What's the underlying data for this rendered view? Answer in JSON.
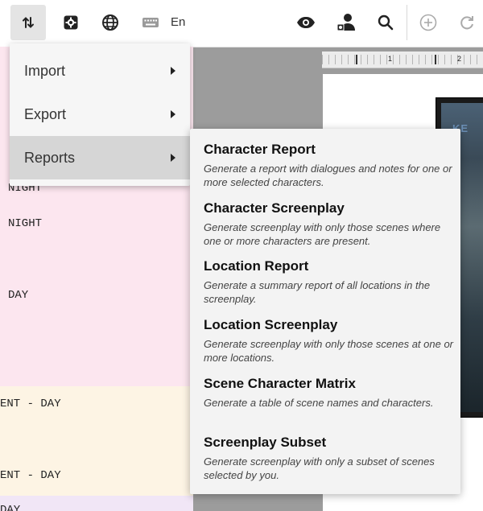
{
  "toolbar": {
    "language_label": "En",
    "icons": [
      "sort-arrows-icon",
      "settings-icon",
      "globe-icon",
      "keyboard-icon",
      "eye-icon",
      "users-icon",
      "search-icon",
      "add-icon",
      "redo-icon"
    ]
  },
  "menu": {
    "items": [
      {
        "label": "Import"
      },
      {
        "label": "Export"
      },
      {
        "label": "Reports"
      }
    ]
  },
  "reports": {
    "items": [
      {
        "title": "Character Report",
        "description": "Generate a report with dialogues and notes for one or more selected characters."
      },
      {
        "title": "Character Screenplay",
        "description": "Generate screenplay with only those scenes where one or more characters are present."
      },
      {
        "title": "Location Report",
        "description": "Generate a summary report of all locations in the screenplay."
      },
      {
        "title": "Location Screenplay",
        "description": "Generate screenplay with only those scenes at one or more locations."
      },
      {
        "title": "Scene Character Matrix",
        "description": "Generate a table of scene names and characters."
      },
      {
        "title": "Screenplay Subset",
        "description": "Generate screenplay with only a subset of scenes selected by you."
      }
    ]
  },
  "script": {
    "lines": [
      "NIGHT",
      "NIGHT",
      "DAY",
      "ENT - DAY",
      "ENT - DAY",
      "DAY"
    ]
  },
  "ruler": {
    "marks": [
      "1",
      "2"
    ]
  },
  "poster": {
    "title": "KE"
  },
  "colors": {
    "scene_pink": "#fce6ef",
    "scene_cream": "#fdf4e4",
    "scene_violet": "#f1e6f6",
    "menu_highlight": "#d6d6d6"
  }
}
